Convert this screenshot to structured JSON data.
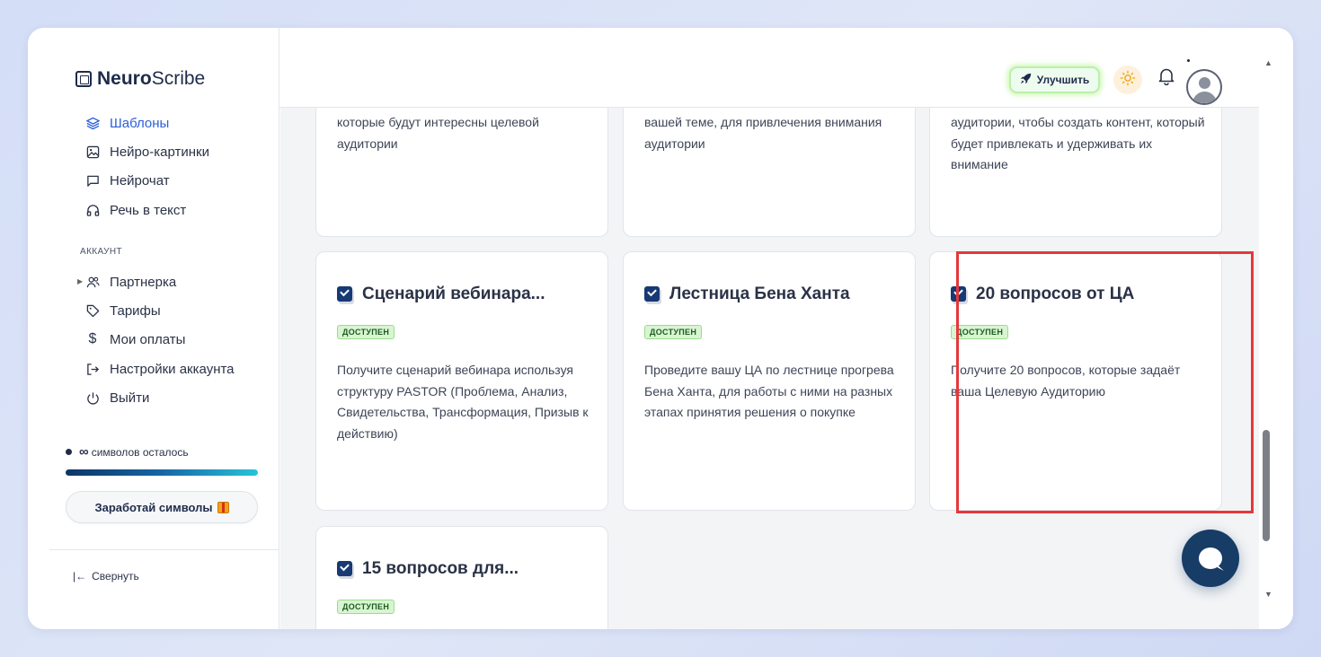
{
  "brand": {
    "bold": "Neuro",
    "regular": "Scribe"
  },
  "sidebar": {
    "items": [
      {
        "label": "Шаблоны",
        "icon": "layers-icon",
        "active": true
      },
      {
        "label": "Нейро-картинки",
        "icon": "image-icon"
      },
      {
        "label": "Нейрочат",
        "icon": "chat-icon"
      },
      {
        "label": "Речь в текст",
        "icon": "headphones-icon"
      }
    ],
    "account_section": "АККАУНТ",
    "account_items": [
      {
        "label": "Партнерка",
        "icon": "users-icon"
      },
      {
        "label": "Тарифы",
        "icon": "tag-icon"
      },
      {
        "label": "Мои оплаты",
        "icon": "dollar-icon"
      },
      {
        "label": "Настройки аккаунта",
        "icon": "login-icon"
      },
      {
        "label": "Выйти",
        "icon": "power-icon"
      }
    ],
    "symbols_infinity": "∞",
    "symbols_label": "символов осталось",
    "symbols_progress": 1.0,
    "earn_button": "Заработай символы",
    "collapse": "Свернуть"
  },
  "topbar": {
    "upgrade_button": "Улучшить"
  },
  "cards": [
    {
      "desc": "которые будут интересны целевой аудитории"
    },
    {
      "desc": "вашей теме, для привлечения внимания аудитории"
    },
    {
      "desc": "аудитории, чтобы создать контент, который будет привлекать и удерживать их внимание"
    },
    {
      "title": "Сценарий вебинара...",
      "badge": "ДОСТУПЕН",
      "desc": "Получите сценарий вебинара используя структуру PASTOR (Проблема, Анализ, Свидетельства, Трансформация, Призыв к действию)"
    },
    {
      "title": "Лестница Бена Ханта",
      "badge": "ДОСТУПЕН",
      "desc": "Проведите вашу ЦА по лестнице прогрева Бена Ханта, для работы с ними на разных этапах принятия решения о покупке"
    },
    {
      "title": "20 вопросов от ЦА",
      "badge": "ДОСТУПЕН",
      "desc": "Получите 20 вопросов, которые задаёт ваша Целевую Аудиторию"
    },
    {
      "title": "15 вопросов для...",
      "badge": "ДОСТУПЕН"
    }
  ],
  "colors": {
    "accent": "#2b5fd9",
    "navy": "#173a74",
    "highlight": "#e5383b",
    "badge_bg": "#d8f5d1"
  }
}
